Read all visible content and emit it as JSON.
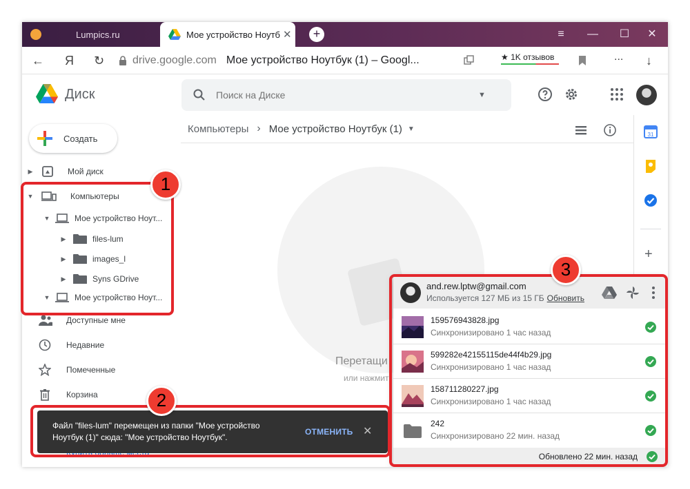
{
  "browser": {
    "tab_inactive": "Lumpics.ru",
    "tab_active": "Мое устройство Ноутбу",
    "tab_close": "✕",
    "new_tab": "+",
    "controls": [
      "≡",
      "—",
      "☐",
      "✕"
    ],
    "nav": {
      "back": "←",
      "ya": "Я",
      "reload": "↻"
    },
    "url_domain": "drive.google.com",
    "url_title": "Мое устройство Ноутбук (1) – Googl...",
    "reviews": "★ 1K отзывов",
    "more": "...",
    "download": "↓"
  },
  "drive": {
    "app_name": "Диск",
    "search_placeholder": "Поиск на Диске",
    "create_label": "Создать",
    "breadcrumb": {
      "root": "Компьютеры",
      "current": "Мое устройство Ноутбук (1)"
    },
    "empty_title": "Перетащи",
    "empty_sub": "или нажмит"
  },
  "sidebar": {
    "my_drive": "Мой диск",
    "computers": "Компьютеры",
    "device1": "Мое устройство Ноут...",
    "folders": [
      "files-lum",
      "images_l",
      "Syns GDrive"
    ],
    "device2": "Мое устройство Ноут...",
    "shared": "Доступные мне",
    "recent": "Недавние",
    "starred": "Помеченные",
    "trash": "Корзина",
    "buy_storage": "Купить больше места"
  },
  "snackbar": {
    "message": "Файл \"files-lum\" перемещен из папки \"Мое устройство Ноутбук (1)\" сюда: \"Мое устройство Ноутбук\".",
    "undo": "ОТМЕНИТЬ",
    "close": "✕"
  },
  "popup": {
    "email": "and.rew.lptw@gmail.com",
    "usage": "Используется 127 МБ из 15 ГБ",
    "upgrade": "Обновить",
    "files": [
      {
        "name": "159576943828.jpg",
        "status": "Синхронизировано 1 час назад"
      },
      {
        "name": "599282e42155115de44f4b29.jpg",
        "status": "Синхронизировано 1 час назад"
      },
      {
        "name": "158711280227.jpg",
        "status": "Синхронизировано 1 час назад"
      },
      {
        "name": "242",
        "status": "Синхронизировано 22 мин. назад"
      }
    ],
    "footer": "Обновлено 22 мин. назад"
  },
  "annotations": {
    "badge1": "1",
    "badge2": "2",
    "badge3": "3"
  },
  "colors": {
    "highlight": "#e3262b",
    "badge": "#ee3b30",
    "ok": "#34a853"
  }
}
